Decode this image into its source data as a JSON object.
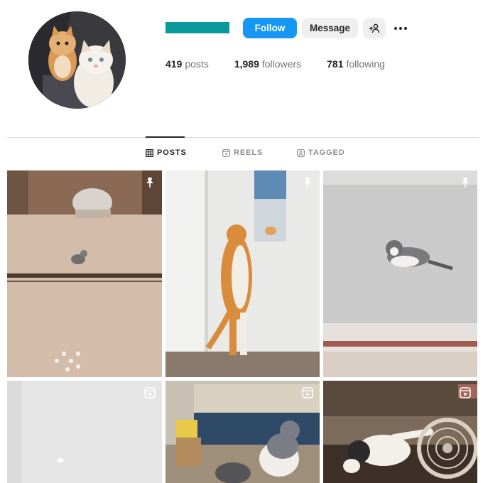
{
  "profile": {
    "stats": [
      {
        "value": "419",
        "label": "posts"
      },
      {
        "value": "1,989",
        "label": "followers"
      },
      {
        "value": "781",
        "label": "following"
      }
    ]
  },
  "actions": {
    "follow_label": "Follow",
    "message_label": "Message"
  },
  "tabs": [
    {
      "label": "POSTS",
      "icon": "grid-icon",
      "active": true
    },
    {
      "label": "REELS",
      "icon": "reels-icon",
      "active": false
    },
    {
      "label": "TAGGED",
      "icon": "tagged-icon",
      "active": false
    }
  ],
  "posts": [
    {
      "badge": "pinned-icon",
      "subject": "kitten on marble floor"
    },
    {
      "badge": "pinned-icon",
      "subject": "orange cat at mirror"
    },
    {
      "badge": "pinned-icon",
      "subject": "grey kitten on wood floor"
    },
    {
      "badge": "reel-icon",
      "subject": "white wall"
    },
    {
      "badge": "reel-icon",
      "subject": "grey and white cat on sofa"
    },
    {
      "badge": "reel-icon",
      "subject": "cat with fan"
    }
  ],
  "colors": {
    "accent": "#1697f6",
    "username_redaction": "#0a9a9e",
    "text": "#262626",
    "muted": "#737373"
  }
}
